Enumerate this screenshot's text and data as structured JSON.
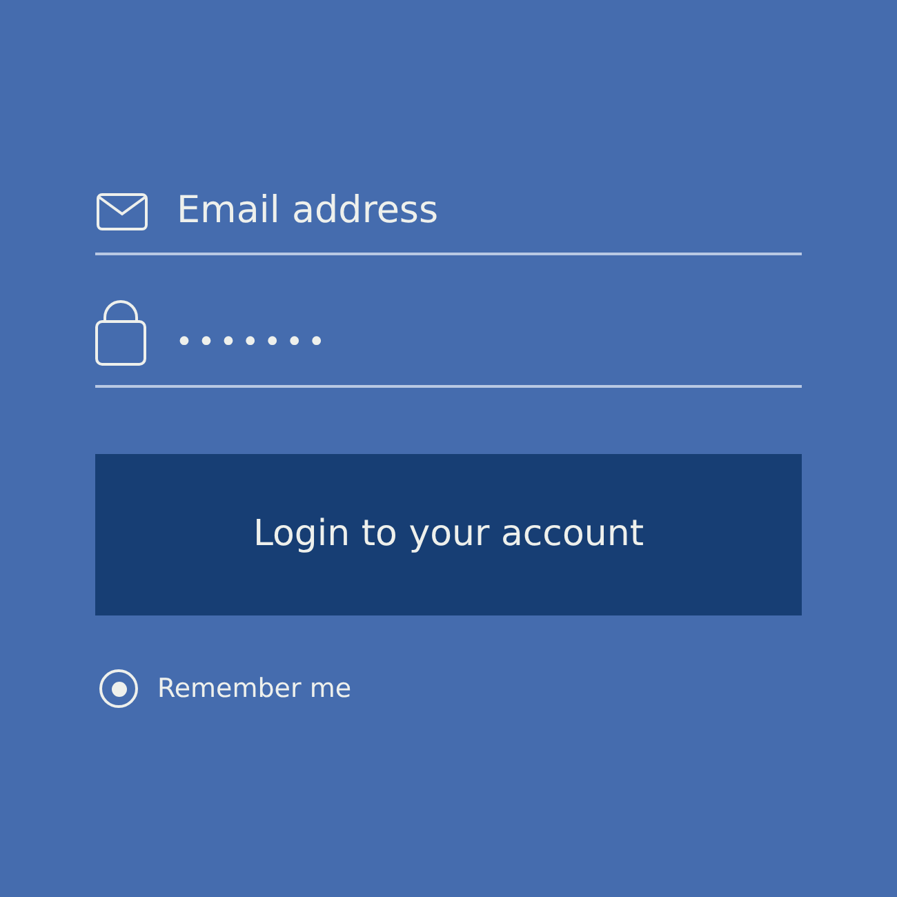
{
  "email": {
    "placeholder": "Email address"
  },
  "password": {
    "value": "•••••••"
  },
  "login_button": {
    "label": "Login to your account"
  },
  "remember": {
    "label": "Remember me",
    "checked": true
  }
}
